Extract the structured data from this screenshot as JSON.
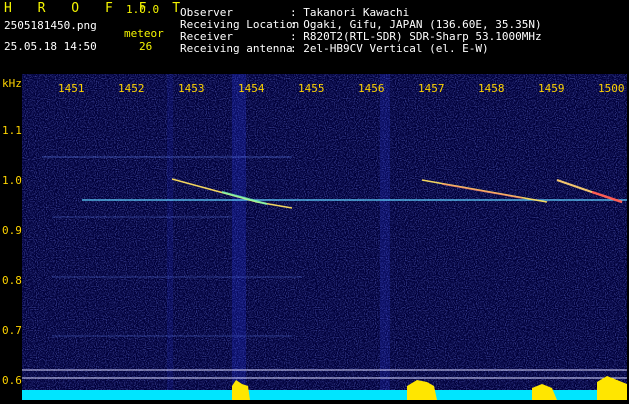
{
  "header": {
    "app_name": "H R O F F T",
    "version": "1.0.0",
    "filename": "2505181450.png",
    "datetime": "25.05.18 14:50",
    "meteor_label": "meteor",
    "meteor_count": "26",
    "fields": [
      {
        "label": "Observer",
        "value": ": Takanori Kawachi"
      },
      {
        "label": "Receiving Location",
        "value": ": Ogaki, Gifu, JAPAN (136.60E, 35.35N)"
      },
      {
        "label": "Receiver",
        "value": ": R820T2(RTL-SDR) SDR-Sharp 53.1000MHz"
      },
      {
        "label": "Receiving antenna",
        "value": ": 2el-HB9CV Vertical (el. E-W)"
      }
    ]
  },
  "axes": {
    "y_unit": "kHz",
    "x_ticks": [
      "1451",
      "1452",
      "1453",
      "1454",
      "1455",
      "1456",
      "1457",
      "1458",
      "1459",
      "1500"
    ],
    "y_ticks": [
      "1.1",
      "1.0",
      "0.9",
      "0.8",
      "0.7",
      "0.6"
    ]
  },
  "colors": {
    "background": "#000000",
    "header_text": "#f5f500",
    "tick_text": "#ffd400",
    "spectrogram_bg": "#00003a",
    "carrier": "#5fd0ff",
    "echo": "#ffe060",
    "baseline": "#00e5ff"
  }
}
